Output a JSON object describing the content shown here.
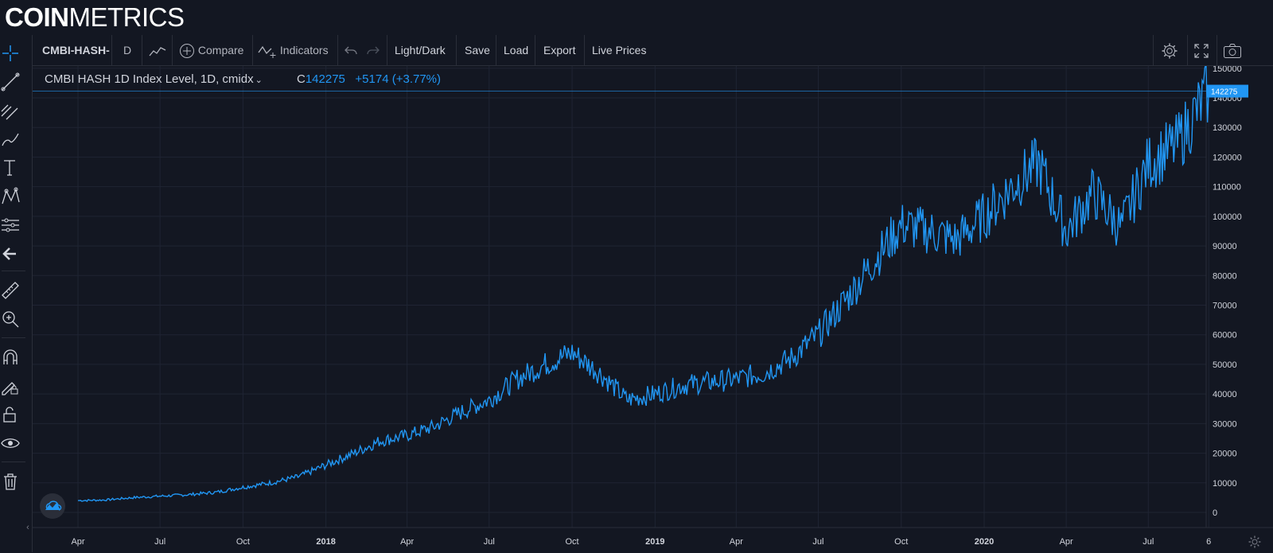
{
  "brand": {
    "bold": "COIN",
    "light": "METRICS"
  },
  "toolbar": {
    "symbol": "CMBI-HASH-",
    "interval": "D",
    "compare": "Compare",
    "indicators": "Indicators",
    "theme": "Light/Dark",
    "save": "Save",
    "load": "Load",
    "export": "Export",
    "live": "Live Prices"
  },
  "legend": {
    "title": "CMBI HASH 1D Index Level, 1D, cmidx",
    "close_prefix": "C",
    "close": "142275",
    "change": "+5174 (+3.77%)"
  },
  "price_badge": "142275",
  "colors": {
    "background": "#131722",
    "series": "#2196f3",
    "grid": "#1f2433",
    "text": "#d1d4dc"
  },
  "chart_data": {
    "type": "line",
    "series": [
      {
        "color": "#2196f3"
      }
    ],
    "x": [
      "2017-04-01",
      "2017-05-01",
      "2017-06-01",
      "2017-07-01",
      "2017-08-01",
      "2017-09-01",
      "2017-10-01",
      "2017-11-01",
      "2017-12-01",
      "2018-01-01",
      "2018-02-01",
      "2018-03-01",
      "2018-04-01",
      "2018-05-01",
      "2018-06-01",
      "2018-07-01",
      "2018-08-01",
      "2018-09-01",
      "2018-10-01",
      "2018-11-01",
      "2018-12-01",
      "2019-01-01",
      "2019-02-01",
      "2019-03-01",
      "2019-04-01",
      "2019-05-01",
      "2019-06-01",
      "2019-07-01",
      "2019-08-01",
      "2019-09-01",
      "2019-10-01",
      "2019-11-01",
      "2019-12-01",
      "2020-01-01",
      "2020-02-01",
      "2020-03-01",
      "2020-04-01",
      "2020-05-01",
      "2020-06-01",
      "2020-07-01",
      "2020-08-01",
      "2020-09-06"
    ],
    "y": [
      4000,
      4200,
      5000,
      5500,
      6000,
      6800,
      8500,
      10000,
      12000,
      16000,
      20000,
      24000,
      26000,
      29000,
      34000,
      38000,
      45000,
      50000,
      54000,
      47000,
      38000,
      40000,
      43000,
      44000,
      45000,
      47000,
      52000,
      60000,
      72000,
      85000,
      97000,
      95000,
      92000,
      100000,
      110000,
      118000,
      95000,
      108000,
      96000,
      118000,
      124000,
      142275
    ],
    "y_ticks": [
      "0",
      "10000",
      "20000",
      "30000",
      "40000",
      "50000",
      "60000",
      "70000",
      "80000",
      "90000",
      "100000",
      "110000",
      "120000",
      "130000",
      "140000",
      "150000"
    ],
    "ylim": [
      0,
      150000
    ],
    "x_ticks": [
      {
        "label": "Apr",
        "date": "2017-04-01",
        "bold": false
      },
      {
        "label": "Jul",
        "date": "2017-07-01",
        "bold": false
      },
      {
        "label": "Oct",
        "date": "2017-10-01",
        "bold": false
      },
      {
        "label": "2018",
        "date": "2018-01-01",
        "bold": true
      },
      {
        "label": "Apr",
        "date": "2018-04-01",
        "bold": false
      },
      {
        "label": "Jul",
        "date": "2018-07-01",
        "bold": false
      },
      {
        "label": "Oct",
        "date": "2018-10-01",
        "bold": false
      },
      {
        "label": "2019",
        "date": "2019-01-01",
        "bold": true
      },
      {
        "label": "Apr",
        "date": "2019-04-01",
        "bold": false
      },
      {
        "label": "Jul",
        "date": "2019-07-01",
        "bold": false
      },
      {
        "label": "Oct",
        "date": "2019-10-01",
        "bold": false
      },
      {
        "label": "2020",
        "date": "2020-01-01",
        "bold": true
      },
      {
        "label": "Apr",
        "date": "2020-04-01",
        "bold": false
      },
      {
        "label": "Jul",
        "date": "2020-07-01",
        "bold": false
      },
      {
        "label": "6",
        "date": "2020-09-06",
        "bold": false
      }
    ],
    "grid": true,
    "last_value": 142275
  }
}
